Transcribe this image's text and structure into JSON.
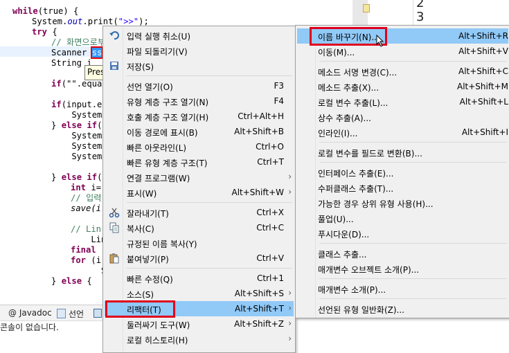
{
  "editor": {
    "lines": [
      {
        "kind": "while",
        "kw": "while",
        "rest": "(true) {"
      },
      {
        "kind": "print",
        "a": "System.",
        "field": "out",
        "b": ".print(",
        "str": "\">>\"",
        "c": ");"
      },
      {
        "kind": "try",
        "kw": "try",
        "rest": " {"
      },
      {
        "kind": "comment",
        "text": "// 화면으로부"
      },
      {
        "kind": "scanner",
        "a": "Scanner ",
        "sel": "ss"
      },
      {
        "kind": "plain",
        "text": "String i"
      },
      {
        "kind": "blank"
      },
      {
        "kind": "ifeq",
        "kw": "if",
        "rest": "(\"\".equa"
      },
      {
        "kind": "blank"
      },
      {
        "kind": "ifinput",
        "kw": "if",
        "rest": "(input.e"
      },
      {
        "kind": "plain",
        "text": "    System"
      },
      {
        "kind": "elseif",
        "a": "} ",
        "kw1": "else",
        "b": " ",
        "kw2": "if",
        "c": "("
      },
      {
        "kind": "plain",
        "text": "    System"
      },
      {
        "kind": "plain",
        "text": "    System"
      },
      {
        "kind": "plain",
        "text": "    System"
      },
      {
        "kind": "blank"
      },
      {
        "kind": "elseif",
        "a": "} ",
        "kw1": "else",
        "b": " ",
        "kw2": "if",
        "c": "("
      },
      {
        "kind": "intline",
        "kw": "int",
        "rest": " i="
      },
      {
        "kind": "comment2",
        "text": "// 입력"
      },
      {
        "kind": "save",
        "text": "save(i"
      },
      {
        "kind": "blank"
      },
      {
        "kind": "comment2",
        "text": "// Lin"
      },
      {
        "kind": "plain",
        "text": "    Linked"
      },
      {
        "kind": "final",
        "kw": "final",
        "rest": " "
      },
      {
        "kind": "for",
        "kw": "for",
        "rest": " (i"
      },
      {
        "kind": "plain",
        "text": "      Sys"
      },
      {
        "kind": "else",
        "a": "} ",
        "kw": "else",
        "b": " {"
      }
    ],
    "tooltip": "Pres"
  },
  "console": {
    "lines": [
      "2",
      "3"
    ]
  },
  "bottom": {
    "tabs": [
      "@ Javadoc",
      "선언"
    ],
    "status": "콘솔이 없습니다."
  },
  "context_menu": [
    {
      "label": "입력 실행 취소(U)",
      "accel": "",
      "arrow": false,
      "icon": "undo-icon"
    },
    {
      "label": "파일 되돌리기(V)",
      "accel": "",
      "arrow": false
    },
    {
      "label": "저장(S)",
      "accel": "",
      "arrow": false,
      "icon": "save-icon"
    },
    {
      "sep": true
    },
    {
      "label": "선언 열기(O)",
      "accel": "F3",
      "arrow": false
    },
    {
      "label": "유형 계층 구조 열기(N)",
      "accel": "F4",
      "arrow": false
    },
    {
      "label": "호출 계층 구조 열기(H)",
      "accel": "Ctrl+Alt+H",
      "arrow": false
    },
    {
      "label": "이동 경로에 표시(B)",
      "accel": "Alt+Shift+B",
      "arrow": false
    },
    {
      "label": "빠른 아웃라인(L)",
      "accel": "Ctrl+O",
      "arrow": false
    },
    {
      "label": "빠른 유형 계층 구조(T)",
      "accel": "Ctrl+T",
      "arrow": false
    },
    {
      "label": "연결 프로그램(W)",
      "accel": "",
      "arrow": true
    },
    {
      "label": "표시(W)",
      "accel": "Alt+Shift+W",
      "arrow": true
    },
    {
      "sep": true
    },
    {
      "label": "잘라내기(T)",
      "accel": "Ctrl+X",
      "arrow": false,
      "icon": "cut-icon"
    },
    {
      "label": "복사(C)",
      "accel": "Ctrl+C",
      "arrow": false,
      "icon": "copy-icon"
    },
    {
      "label": "규정된 이름 복사(Y)",
      "accel": "",
      "arrow": false
    },
    {
      "label": "붙여넣기(P)",
      "accel": "Ctrl+V",
      "arrow": false,
      "icon": "paste-icon"
    },
    {
      "sep": true
    },
    {
      "label": "빠른 수정(Q)",
      "accel": "Ctrl+1",
      "arrow": false
    },
    {
      "label": "소스(S)",
      "accel": "Alt+Shift+S",
      "arrow": true
    },
    {
      "label": "리팩터(T)",
      "accel": "Alt+Shift+T",
      "arrow": true,
      "active": true
    },
    {
      "label": "둘러싸기 도구(W)",
      "accel": "Alt+Shift+Z",
      "arrow": true
    },
    {
      "label": "로컬 히스토리(H)",
      "accel": "",
      "arrow": true
    }
  ],
  "refactor_menu": [
    {
      "label": "이름 바꾸기(N)...",
      "accel": "Alt+Shift+R",
      "active": true
    },
    {
      "label": "이동(M)...",
      "accel": "Alt+Shift+V"
    },
    {
      "sep": true
    },
    {
      "label": "메소드 서명 변경(C)...",
      "accel": "Alt+Shift+C"
    },
    {
      "label": "메소드 추출(X)...",
      "accel": "Alt+Shift+M"
    },
    {
      "label": "로컬 변수 추출(L)...",
      "accel": "Alt+Shift+L"
    },
    {
      "label": "상수 추출(A)...",
      "accel": ""
    },
    {
      "label": "인라인(I)...",
      "accel": "Alt+Shift+I"
    },
    {
      "sep": true
    },
    {
      "label": "로컬 변수를 필드로 변환(B)...",
      "accel": ""
    },
    {
      "sep": true
    },
    {
      "label": "인터페이스 추출(E)...",
      "accel": ""
    },
    {
      "label": "수퍼클래스 추출(T)...",
      "accel": ""
    },
    {
      "label": "가능한 경우 상위 유형 사용(H)...",
      "accel": ""
    },
    {
      "label": "풀업(U)...",
      "accel": ""
    },
    {
      "label": "푸시다운(D)...",
      "accel": ""
    },
    {
      "sep": true
    },
    {
      "label": "클래스 추출...",
      "accel": ""
    },
    {
      "label": "매개변수 오브젝트 소개(P)...",
      "accel": ""
    },
    {
      "sep": true
    },
    {
      "label": "매개변수 소개(P)...",
      "accel": ""
    },
    {
      "sep": true
    },
    {
      "label": "선언된 유형 일반화(Z)...",
      "accel": ""
    }
  ]
}
